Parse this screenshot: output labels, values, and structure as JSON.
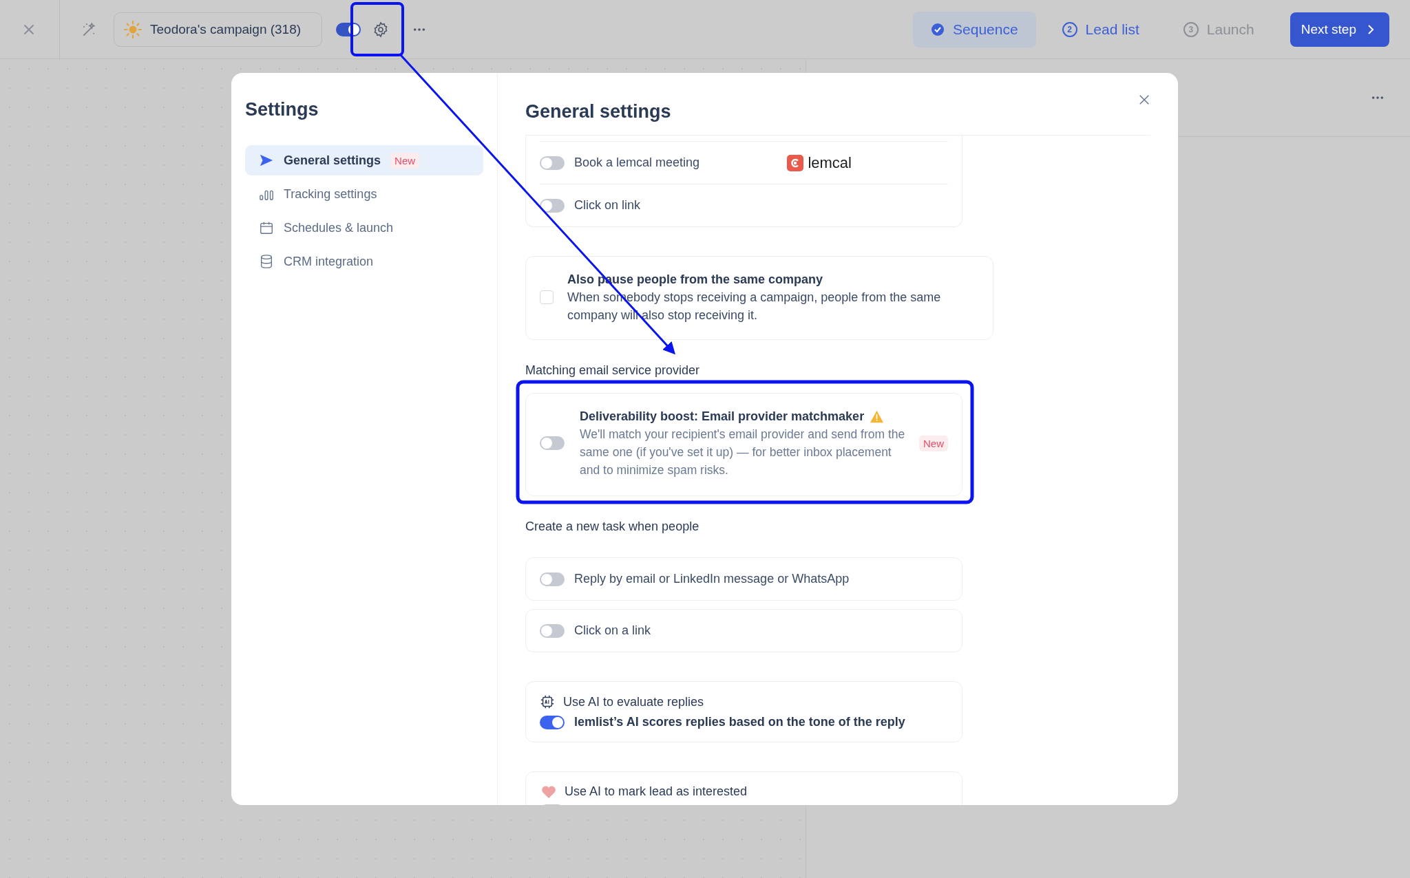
{
  "topbar": {
    "campaign": {
      "name": "Teodora's campaign (318)"
    },
    "campaign_toggle": {
      "on": true
    },
    "steps": [
      {
        "label": "Sequence",
        "completed": true,
        "disabled": false,
        "selected": true
      },
      {
        "label": "Lead list",
        "number": "2",
        "completed": false,
        "disabled": false,
        "selected": false
      },
      {
        "label": "Launch",
        "number": "3",
        "completed": false,
        "disabled": true,
        "selected": false
      }
    ],
    "next_button": "Next step"
  },
  "settings": {
    "title": "Settings",
    "nav": [
      {
        "label": "General settings",
        "badge": "New",
        "selected": true
      },
      {
        "label": "Tracking settings",
        "selected": false
      },
      {
        "label": "Schedules & launch",
        "selected": false
      },
      {
        "label": "CRM integration",
        "selected": false
      }
    ],
    "page_title": "General settings",
    "sections": [
      {
        "kind": "toggle_card",
        "rows": [
          {
            "label": "Book a lemcal meeting",
            "on": false,
            "logo": "lemcal"
          },
          {
            "label": "Click on link",
            "on": false
          }
        ]
      },
      {
        "kind": "checkbox_card",
        "title": "Also pause people from the same company",
        "description": "When somebody stops receiving a campaign, people from the same company will also stop receiving it.",
        "checked": false
      },
      {
        "kind": "heading",
        "text": "Matching email service provider"
      },
      {
        "kind": "feature_card",
        "title": "Deliverability boost: Email provider matchmaker",
        "description": "We'll match your recipient's email provider and send from the same one (if you've set it up) — for better inbox placement and to minimize spam risks.",
        "on": false,
        "warning": true,
        "badge": "New"
      },
      {
        "kind": "heading",
        "text": "Create a new task when people"
      },
      {
        "kind": "toggle_card",
        "rows": [
          {
            "label": "Reply by email or LinkedIn message or WhatsApp",
            "on": false
          }
        ]
      },
      {
        "kind": "toggle_card",
        "rows": [
          {
            "label": "Click on a link",
            "on": false
          }
        ]
      },
      {
        "kind": "ai_card",
        "title": "Use AI to evaluate replies",
        "toggle_label": "lemlist’s AI scores replies based on the tone of the reply",
        "on": true
      },
      {
        "kind": "ai_card",
        "title": "Use AI to mark lead as interested",
        "on": false
      }
    ]
  }
}
